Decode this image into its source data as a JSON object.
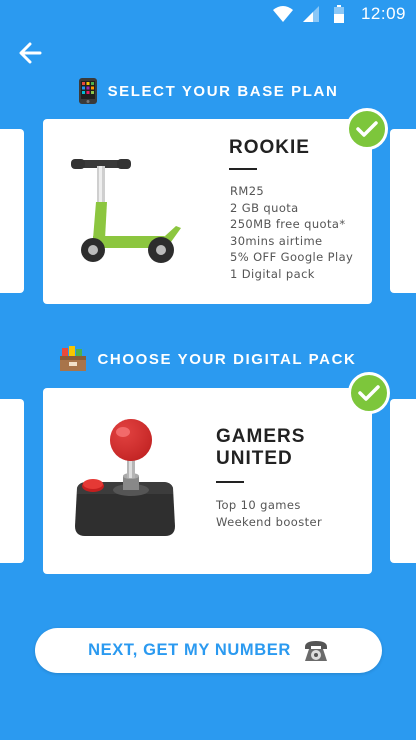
{
  "status_bar": {
    "time": "12:09",
    "icons": [
      "wifi-icon",
      "cell-signal-icon",
      "battery-icon"
    ]
  },
  "nav": {
    "back_icon": "arrow-left-icon"
  },
  "sections": {
    "base_plan": {
      "title": "SELECT YOUR BASE PLAN",
      "icon": "mobile-phone-icon",
      "selected_card": {
        "name": "ROOKIE",
        "image": "scooter-illustration",
        "details": [
          "RM25",
          "2 GB quota",
          "250MB free quota*",
          "30mins airtime",
          "5% OFF Google Play",
          "1 Digital pack"
        ],
        "selected": true
      }
    },
    "digital_pack": {
      "title": "CHOOSE YOUR DIGITAL PACK",
      "icon": "package-box-icon",
      "selected_card": {
        "name_line1": "GAMERS",
        "name_line2": "UNITED",
        "image": "joystick-illustration",
        "details": [
          "Top 10 games",
          "Weekend booster"
        ],
        "selected": true
      }
    }
  },
  "next_button": {
    "label": "NEXT, GET MY NUMBER",
    "icon": "telephone-icon"
  },
  "colors": {
    "background": "#2B9AF0",
    "check": "#7DC63B",
    "scooter": "#8CC63F"
  }
}
